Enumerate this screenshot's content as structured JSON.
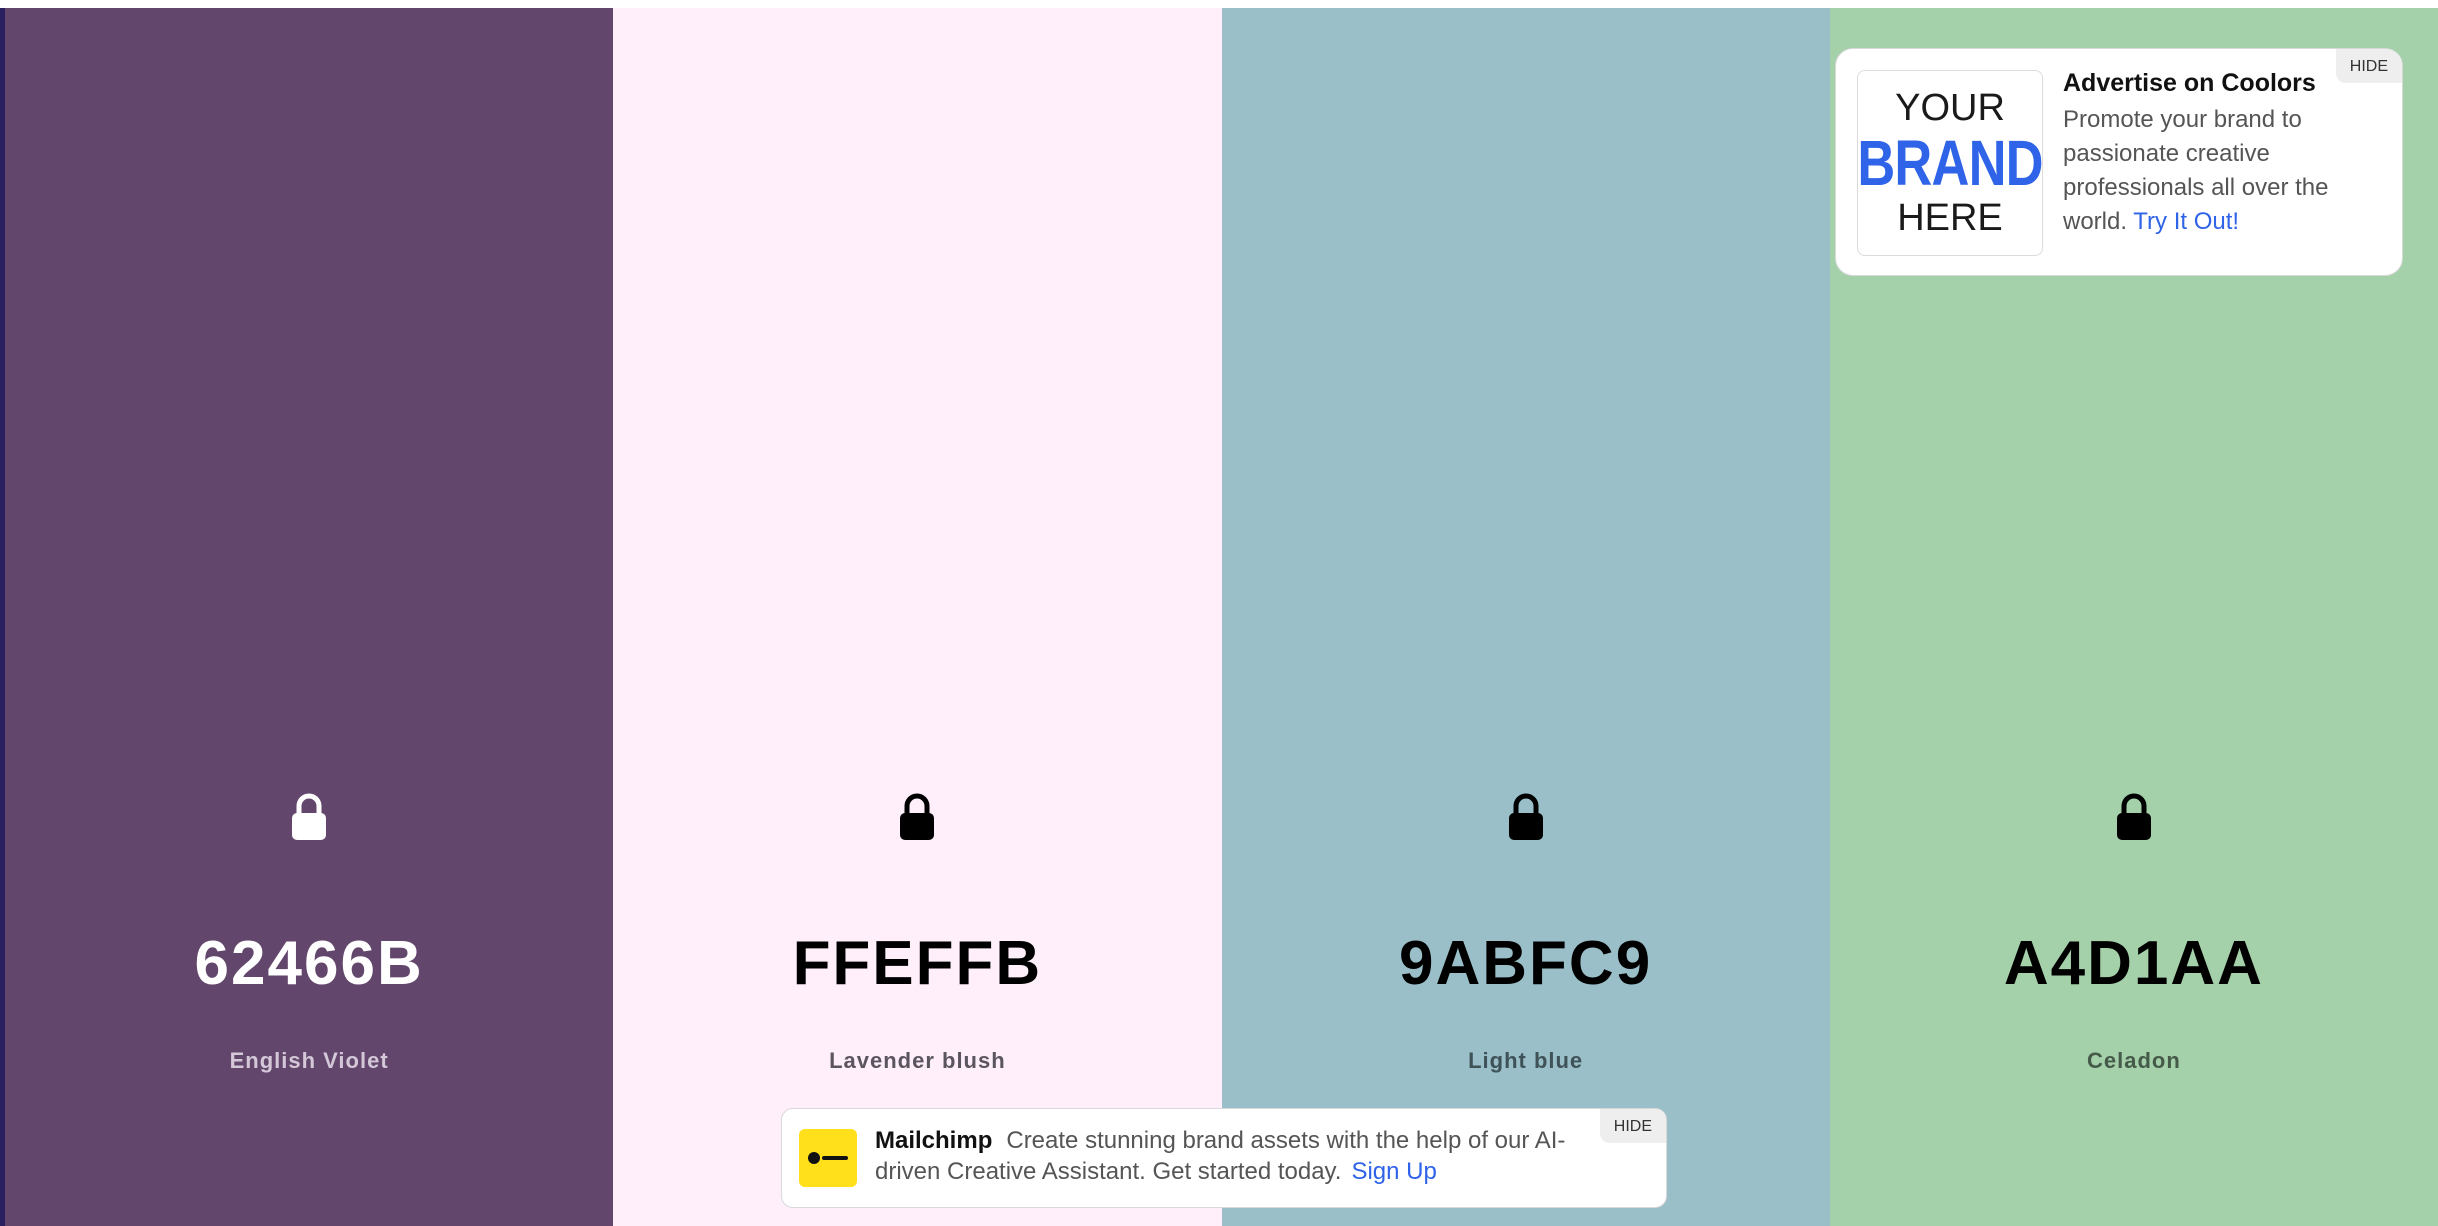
{
  "palette": {
    "swatches": [
      {
        "hex": "62466B",
        "name": "English Violet",
        "bg": "#62466B",
        "text_color": "#ffffff",
        "name_color": "#d3c7d8",
        "lock_color": "#ffffff"
      },
      {
        "hex": "FFEFFB",
        "name": "Lavender blush",
        "bg": "#FFEFFB",
        "text_color": "#000000",
        "name_color": "#5b5560",
        "lock_color": "#000000"
      },
      {
        "hex": "9ABFC9",
        "name": "Light blue",
        "bg": "#9ABFC9",
        "text_color": "#000000",
        "name_color": "#3f5258",
        "lock_color": "#000000"
      },
      {
        "hex": "A4D1AA",
        "name": "Celadon",
        "bg": "#A4D1AA",
        "text_color": "#000000",
        "name_color": "#455a48",
        "lock_color": "#000000"
      }
    ]
  },
  "ad": {
    "logo_line1": "YOUR",
    "logo_line2": "BRAND",
    "logo_line3": "HERE",
    "title": "Advertise on Coolors",
    "body": "Promote your brand to passionate creative professionals all over the world.",
    "link": "Try It Out!",
    "hide_label": "HIDE"
  },
  "banner": {
    "brand": "Mailchimp",
    "text": "Create stunning brand assets with the help of our AI-driven Creative Assistant. Get started today.",
    "link": "Sign Up",
    "hide_label": "HIDE",
    "logo_icon": "mailchimp-logo-icon"
  }
}
